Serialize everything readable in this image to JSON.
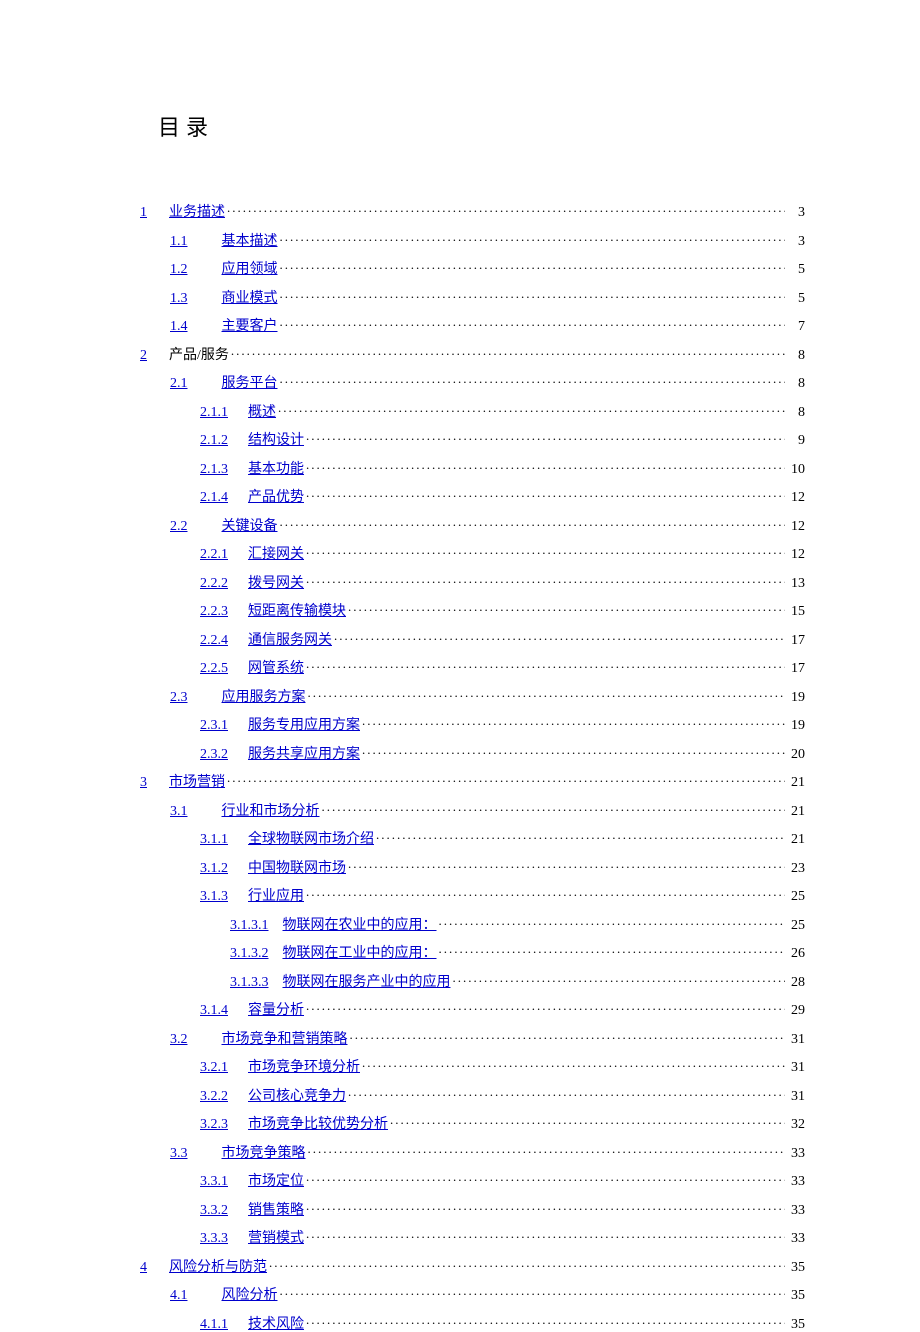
{
  "title": "目录",
  "toc": [
    {
      "level": 0,
      "num": "1",
      "text": "业务描述",
      "link": true,
      "page": 3
    },
    {
      "level": 1,
      "num": "1.1",
      "text": "基本描述",
      "link": true,
      "page": 3
    },
    {
      "level": 1,
      "num": "1.2",
      "text": "应用领域",
      "link": true,
      "page": 5
    },
    {
      "level": 1,
      "num": "1.3",
      "text": "商业模式",
      "link": true,
      "page": 5
    },
    {
      "level": 1,
      "num": "1.4",
      "text": "主要客户",
      "link": true,
      "page": 7
    },
    {
      "level": 0,
      "num": "2",
      "text": "产品/服务",
      "link": false,
      "page": 8
    },
    {
      "level": 1,
      "num": "2.1",
      "text": "服务平台",
      "link": true,
      "page": 8
    },
    {
      "level": 2,
      "num": "2.1.1",
      "text": "概述",
      "link": true,
      "page": 8
    },
    {
      "level": 2,
      "num": "2.1.2",
      "text": "结构设计",
      "link": true,
      "page": 9
    },
    {
      "level": 2,
      "num": "2.1.3",
      "text": "基本功能",
      "link": true,
      "page": 10
    },
    {
      "level": 2,
      "num": "2.1.4",
      "text": "产品优势",
      "link": true,
      "page": 12
    },
    {
      "level": 1,
      "num": "2.2",
      "text": "关键设备",
      "link": true,
      "page": 12
    },
    {
      "level": 2,
      "num": "2.2.1",
      "text": "汇接网关",
      "link": true,
      "page": 12
    },
    {
      "level": 2,
      "num": "2.2.2",
      "text": "拨号网关",
      "link": true,
      "page": 13
    },
    {
      "level": 2,
      "num": "2.2.3",
      "text": "短距离传输模块",
      "link": true,
      "page": 15
    },
    {
      "level": 2,
      "num": "2.2.4",
      "text": "通信服务网关",
      "link": true,
      "page": 17
    },
    {
      "level": 2,
      "num": "2.2.5",
      "text": "网管系统",
      "link": true,
      "page": 17
    },
    {
      "level": 1,
      "num": "2.3",
      "text": "应用服务方案",
      "link": true,
      "page": 19
    },
    {
      "level": 2,
      "num": "2.3.1",
      "text": "服务专用应用方案",
      "link": true,
      "page": 19
    },
    {
      "level": 2,
      "num": "2.3.2",
      "text": "服务共享应用方案",
      "link": true,
      "page": 20
    },
    {
      "level": 0,
      "num": "3",
      "text": "市场营销",
      "link": true,
      "page": 21
    },
    {
      "level": 1,
      "num": "3.1",
      "text": "行业和市场分析",
      "link": true,
      "page": 21
    },
    {
      "level": 2,
      "num": "3.1.1",
      "text": "全球物联网市场介绍",
      "link": true,
      "page": 21
    },
    {
      "level": 2,
      "num": "3.1.2",
      "text": "中国物联网市场",
      "link": true,
      "page": 23
    },
    {
      "level": 2,
      "num": "3.1.3",
      "text": "行业应用",
      "link": true,
      "page": 25
    },
    {
      "level": 3,
      "num": "3.1.3.1",
      "text": "物联网在农业中的应用：",
      "link": true,
      "page": 25
    },
    {
      "level": 3,
      "num": "3.1.3.2",
      "text": "物联网在工业中的应用：",
      "link": true,
      "page": 26
    },
    {
      "level": 3,
      "num": "3.1.3.3",
      "text": "物联网在服务产业中的应用",
      "link": true,
      "page": 28
    },
    {
      "level": 2,
      "num": "3.1.4",
      "text": "容量分析",
      "link": true,
      "page": 29
    },
    {
      "level": 1,
      "num": "3.2",
      "text": "市场竞争和营销策略",
      "link": true,
      "page": 31
    },
    {
      "level": 2,
      "num": "3.2.1",
      "text": "市场竞争环境分析",
      "link": true,
      "page": 31
    },
    {
      "level": 2,
      "num": "3.2.2",
      "text": "公司核心竞争力",
      "link": true,
      "page": 31
    },
    {
      "level": 2,
      "num": "3.2.3",
      "text": "市场竞争比较优势分析",
      "link": true,
      "page": 32
    },
    {
      "level": 1,
      "num": "3.3",
      "text": "市场竞争策略",
      "link": true,
      "page": 33
    },
    {
      "level": 2,
      "num": "3.3.1",
      "text": "市场定位",
      "link": true,
      "page": 33
    },
    {
      "level": 2,
      "num": "3.3.2",
      "text": "销售策略",
      "link": true,
      "page": 33
    },
    {
      "level": 2,
      "num": "3.3.3",
      "text": "营销模式",
      "link": true,
      "page": 33
    },
    {
      "level": 0,
      "num": "4",
      "text": "风险分析与防范",
      "link": true,
      "page": 35
    },
    {
      "level": 1,
      "num": "4.1",
      "text": "风险分析",
      "link": true,
      "page": 35
    },
    {
      "level": 2,
      "num": "4.1.1",
      "text": "技术风险",
      "link": true,
      "page": 35
    }
  ],
  "layout": {
    "indents": [
      0,
      30,
      60,
      90
    ],
    "gapAfterNum": [
      22,
      34,
      20,
      14
    ]
  }
}
